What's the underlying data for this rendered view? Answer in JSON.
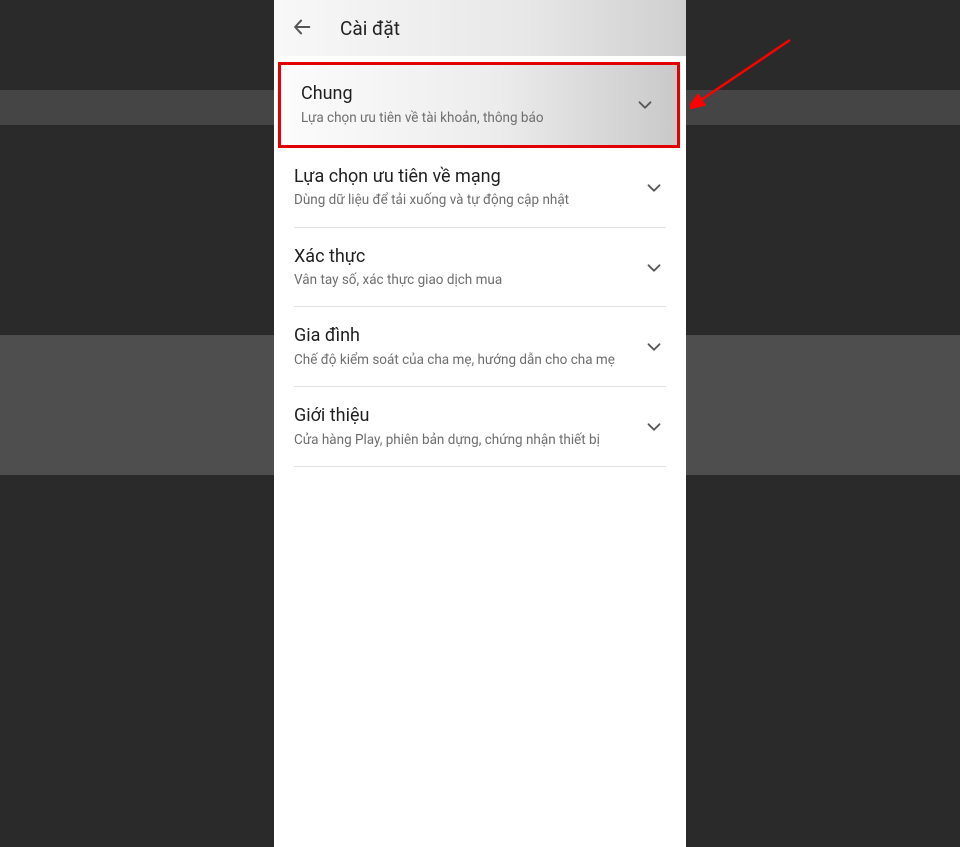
{
  "annotation": {
    "highlight_color": "#e30000",
    "arrow_color": "#ff0000"
  },
  "header": {
    "title": "Cài đặt"
  },
  "sections": [
    {
      "title": "Chung",
      "subtitle": "Lựa chọn ưu tiên về tài khoản, thông báo",
      "highlighted": true
    },
    {
      "title": "Lựa chọn ưu tiên về mạng",
      "subtitle": "Dùng dữ liệu để tải xuống và tự động cập nhật"
    },
    {
      "title": "Xác thực",
      "subtitle": "Vân tay số, xác thực giao dịch mua"
    },
    {
      "title": "Gia đình",
      "subtitle": "Chế độ kiểm soát của cha mẹ, hướng dẫn cho cha mẹ"
    },
    {
      "title": "Giới thiệu",
      "subtitle": "Cửa hàng Play, phiên bản dựng, chứng nhận thiết bị"
    }
  ]
}
